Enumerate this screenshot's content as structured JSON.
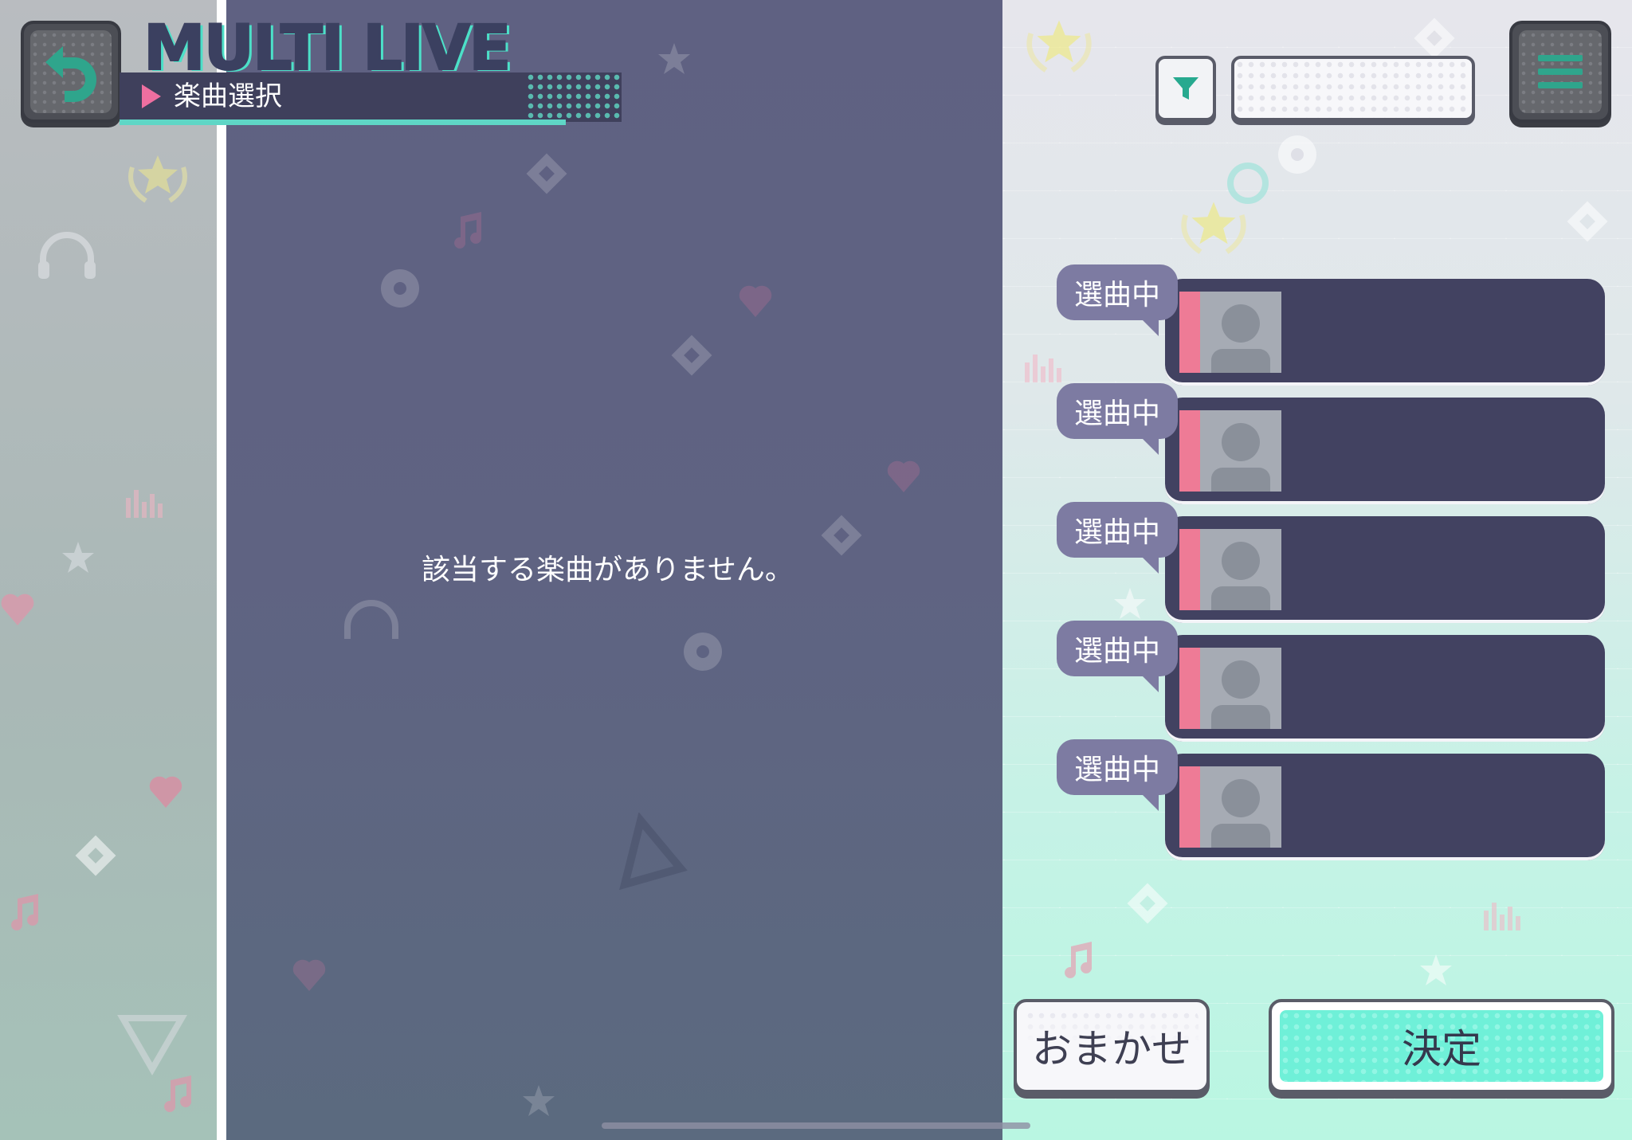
{
  "header": {
    "logo_text": "MULTI LIVE",
    "subtitle": "楽曲選択"
  },
  "icons": {
    "back": "back-arrow-icon",
    "filter": "filter-funnel-icon",
    "menu": "hamburger-menu-icon"
  },
  "search": {
    "value": ""
  },
  "song_list": {
    "empty_message": "該当する楽曲がありません。"
  },
  "players": [
    {
      "status": "選曲中"
    },
    {
      "status": "選曲中"
    },
    {
      "status": "選曲中"
    },
    {
      "status": "選曲中"
    },
    {
      "status": "選曲中"
    }
  ],
  "buttons": {
    "omakase": "おまかせ",
    "decide": "決定"
  },
  "colors": {
    "accent_teal": "#5fd6c6",
    "accent_pink": "#ee7b96",
    "panel_dark": "#424261",
    "decide_green": "#6ff0d8"
  }
}
